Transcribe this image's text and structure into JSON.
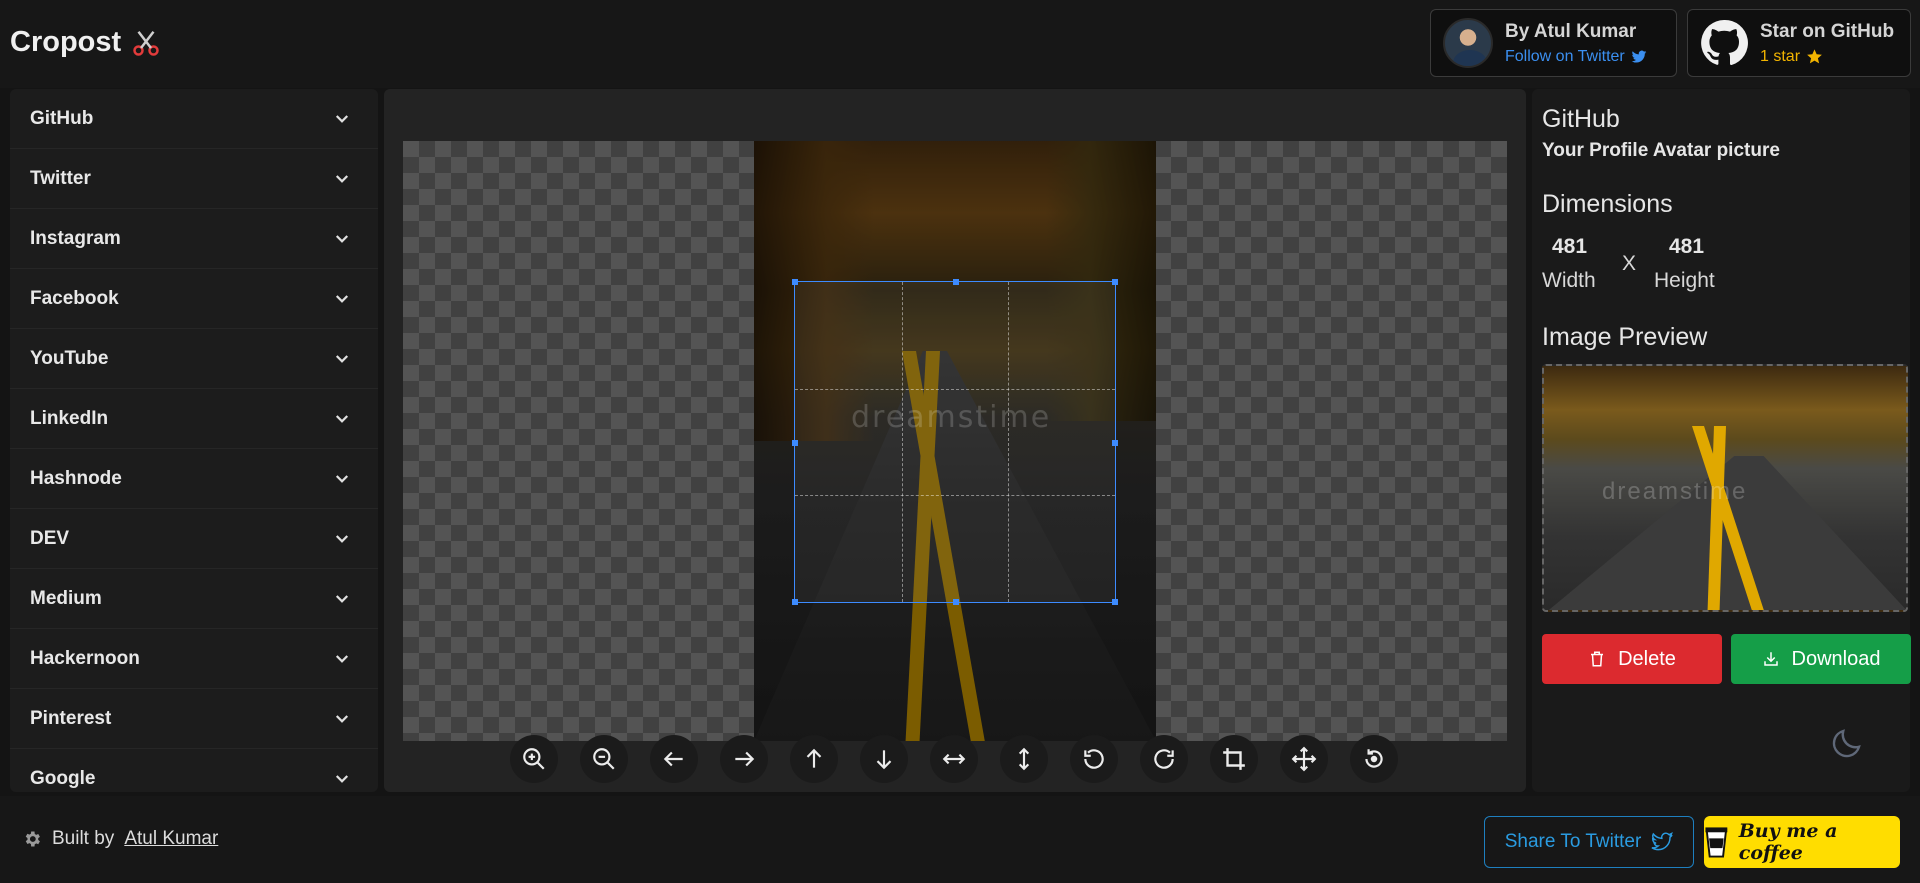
{
  "header": {
    "brand": "Cropost",
    "author_title": "By Atul Kumar",
    "author_sub": "Follow on Twitter",
    "github_title": "Star on GitHub",
    "github_sub": "1 star"
  },
  "sidebar": {
    "items": [
      {
        "label": "GitHub"
      },
      {
        "label": "Twitter"
      },
      {
        "label": "Instagram"
      },
      {
        "label": "Facebook"
      },
      {
        "label": "YouTube"
      },
      {
        "label": "LinkedIn"
      },
      {
        "label": "Hashnode"
      },
      {
        "label": "DEV"
      },
      {
        "label": "Medium"
      },
      {
        "label": "Hackernoon"
      },
      {
        "label": "Pinterest"
      },
      {
        "label": "Google"
      }
    ]
  },
  "editor": {
    "watermark": "dreamstime",
    "tools": [
      "zoom-in",
      "zoom-out",
      "move-left",
      "move-right",
      "move-up",
      "move-down",
      "flip-horizontal",
      "flip-vertical",
      "rotate-left",
      "rotate-right",
      "crop",
      "move",
      "reset"
    ]
  },
  "panel": {
    "platform": "GitHub",
    "subtitle": "Your Profile Avatar picture",
    "dimensions_title": "Dimensions",
    "width_value": "481",
    "width_label": "Width",
    "separator": "X",
    "height_value": "481",
    "height_label": "Height",
    "preview_title": "Image Preview",
    "delete_label": "Delete",
    "download_label": "Download"
  },
  "footer": {
    "built_by": "Built by",
    "author_link": "Atul Kumar",
    "share_label": "Share To Twitter",
    "coffee_label": "Buy me a coffee"
  },
  "colors": {
    "accent_blue": "#3d8bff",
    "delete_red": "#dc2a2f",
    "download_green": "#159e48",
    "coffee_yellow": "#ffdd00",
    "twitter_blue": "#2a9be0"
  }
}
